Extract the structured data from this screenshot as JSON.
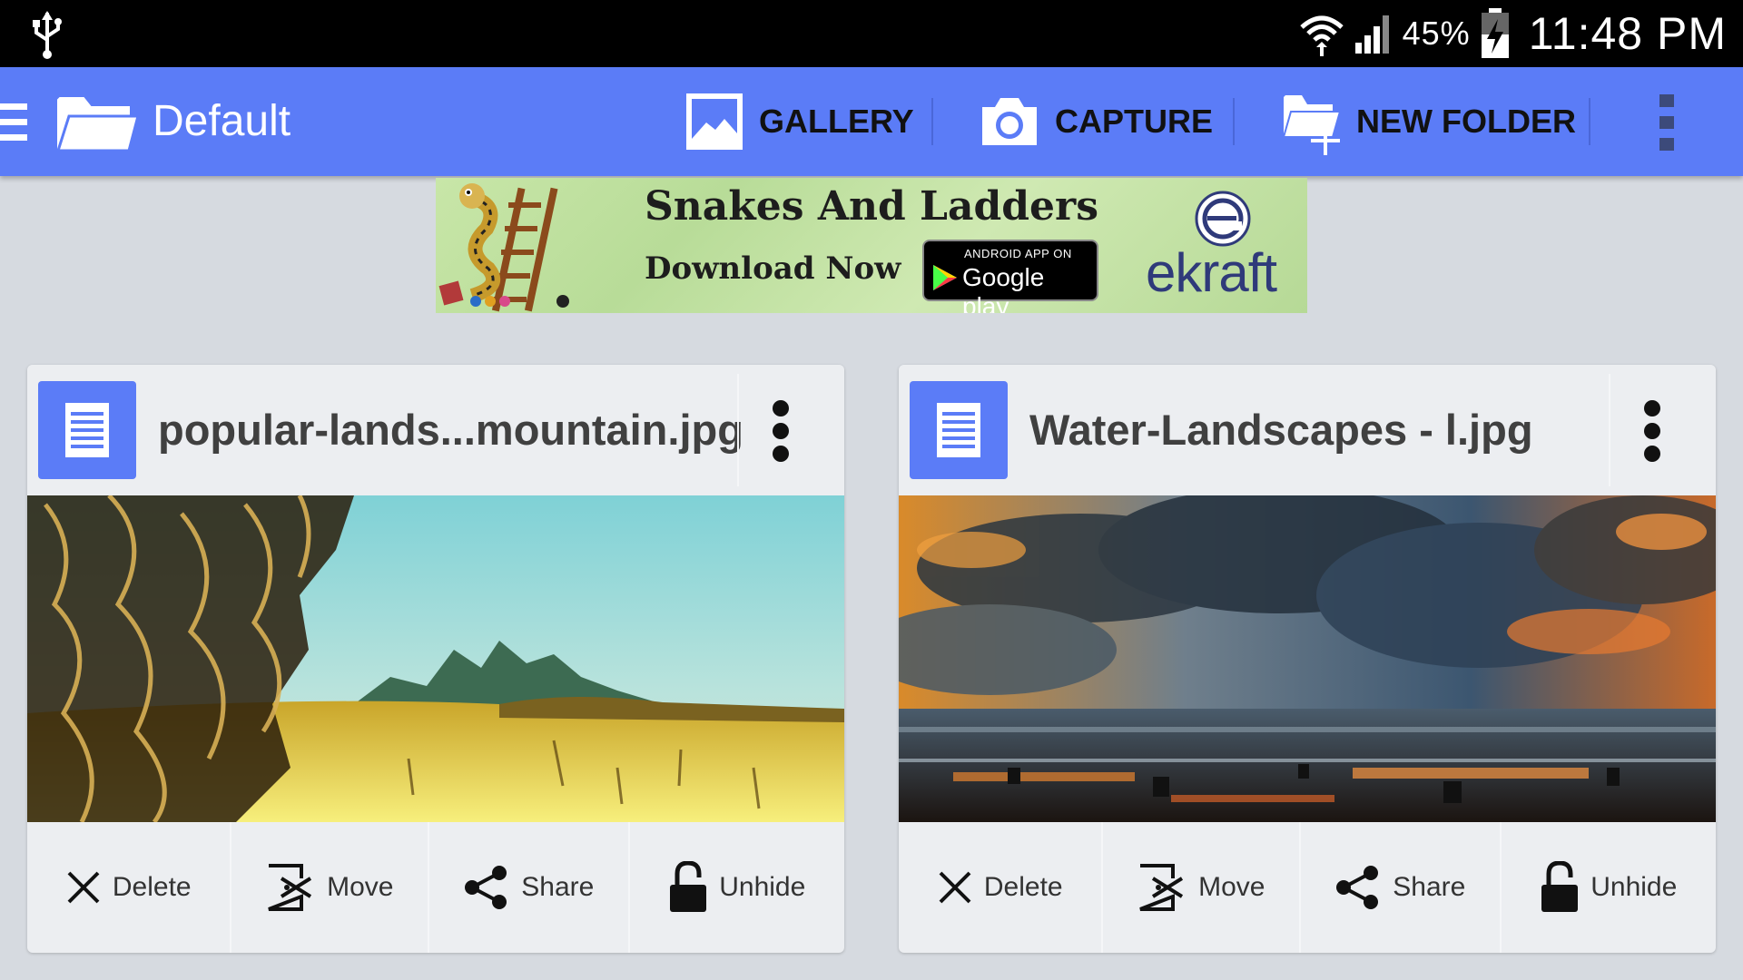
{
  "status_bar": {
    "battery_percent": "45%",
    "time": "11:48 PM",
    "icons": [
      "usb-icon",
      "wifi-icon",
      "signal-icon",
      "battery-charging-icon"
    ]
  },
  "action_bar": {
    "title": "Default",
    "buttons": [
      {
        "label": "GALLERY",
        "icon": "gallery-icon"
      },
      {
        "label": "CAPTURE",
        "icon": "camera-icon"
      },
      {
        "label": "NEW FOLDER",
        "icon": "new-folder-icon"
      }
    ],
    "accent_color": "#5b7cf7"
  },
  "ad_banner": {
    "title": "Snakes And Ladders",
    "subtitle": "Download Now",
    "store_small": "ANDROID APP ON",
    "store_big": "Google play",
    "brand": "ekraft"
  },
  "cards": [
    {
      "filename": "popular-lands...mountain.jpg",
      "actions": [
        {
          "label": "Delete",
          "icon": "close-icon"
        },
        {
          "label": "Move",
          "icon": "move-icon"
        },
        {
          "label": "Share",
          "icon": "share-icon"
        },
        {
          "label": "Unhide",
          "icon": "unlock-icon"
        }
      ]
    },
    {
      "filename": "Water-Landscapes - l.jpg",
      "actions": [
        {
          "label": "Delete",
          "icon": "close-icon"
        },
        {
          "label": "Move",
          "icon": "move-icon"
        },
        {
          "label": "Share",
          "icon": "share-icon"
        },
        {
          "label": "Unhide",
          "icon": "unlock-icon"
        }
      ]
    }
  ]
}
